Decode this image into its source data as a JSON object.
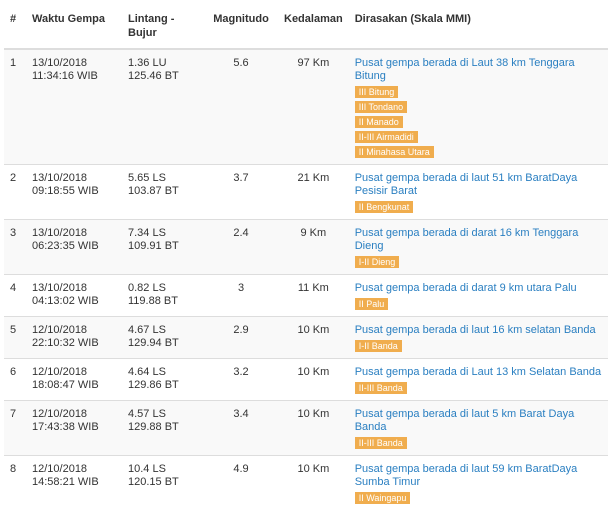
{
  "headers": {
    "num": "#",
    "time": "Waktu Gempa",
    "coord": "Lintang - Bujur",
    "mag": "Magnitudo",
    "depth": "Kedalaman",
    "felt": "Dirasakan (Skala MMI)"
  },
  "rows": [
    {
      "num": "1",
      "date": "13/10/2018",
      "time": "11:34:16 WIB",
      "lat": "1.36 LU",
      "lon": "125.46 BT",
      "mag": "5.6",
      "depth": "97 Km",
      "desc": "Pusat gempa berada di Laut 38 km Tenggara Bitung",
      "felt": [
        "III Bitung",
        "III Tondano",
        "II Manado",
        "II-III Airmadidi",
        "II Minahasa Utara"
      ]
    },
    {
      "num": "2",
      "date": "13/10/2018",
      "time": "09:18:55 WIB",
      "lat": "5.65 LS",
      "lon": "103.87 BT",
      "mag": "3.7",
      "depth": "21 Km",
      "desc": "Pusat gempa berada di laut 51 km BaratDaya Pesisir Barat",
      "felt": [
        "II Bengkunat"
      ]
    },
    {
      "num": "3",
      "date": "13/10/2018",
      "time": "06:23:35 WIB",
      "lat": "7.34 LS",
      "lon": "109.91 BT",
      "mag": "2.4",
      "depth": "9 Km",
      "desc": "Pusat gempa berada di darat 16 km Tenggara Dieng",
      "felt": [
        "I-II Dieng"
      ]
    },
    {
      "num": "4",
      "date": "13/10/2018",
      "time": "04:13:02 WIB",
      "lat": "0.82 LS",
      "lon": "119.88 BT",
      "mag": "3",
      "depth": "11 Km",
      "desc": "Pusat gempa berada di darat 9 km utara Palu",
      "felt": [
        "II Palu"
      ]
    },
    {
      "num": "5",
      "date": "12/10/2018",
      "time": "22:10:32 WIB",
      "lat": "4.67 LS",
      "lon": "129.94 BT",
      "mag": "2.9",
      "depth": "10 Km",
      "desc": "Pusat gempa berada di laut 16 km selatan Banda",
      "felt": [
        "I-II Banda"
      ]
    },
    {
      "num": "6",
      "date": "12/10/2018",
      "time": "18:08:47 WIB",
      "lat": "4.64 LS",
      "lon": "129.86 BT",
      "mag": "3.2",
      "depth": "10 Km",
      "desc": "Pusat gempa berada di Laut 13 km Selatan Banda",
      "felt": [
        "II-III Banda"
      ]
    },
    {
      "num": "7",
      "date": "12/10/2018",
      "time": "17:43:38 WIB",
      "lat": "4.57 LS",
      "lon": "129.88 BT",
      "mag": "3.4",
      "depth": "10 Km",
      "desc": "Pusat gempa berada di laut 5 km Barat Daya Banda",
      "felt": [
        "II-III Banda"
      ]
    },
    {
      "num": "8",
      "date": "12/10/2018",
      "time": "14:58:21 WIB",
      "lat": "10.4 LS",
      "lon": "120.15 BT",
      "mag": "4.9",
      "depth": "10 Km",
      "desc": "Pusat gempa berada di laut 59 km BaratDaya Sumba Timur",
      "felt": [
        "II Waingapu"
      ]
    }
  ]
}
